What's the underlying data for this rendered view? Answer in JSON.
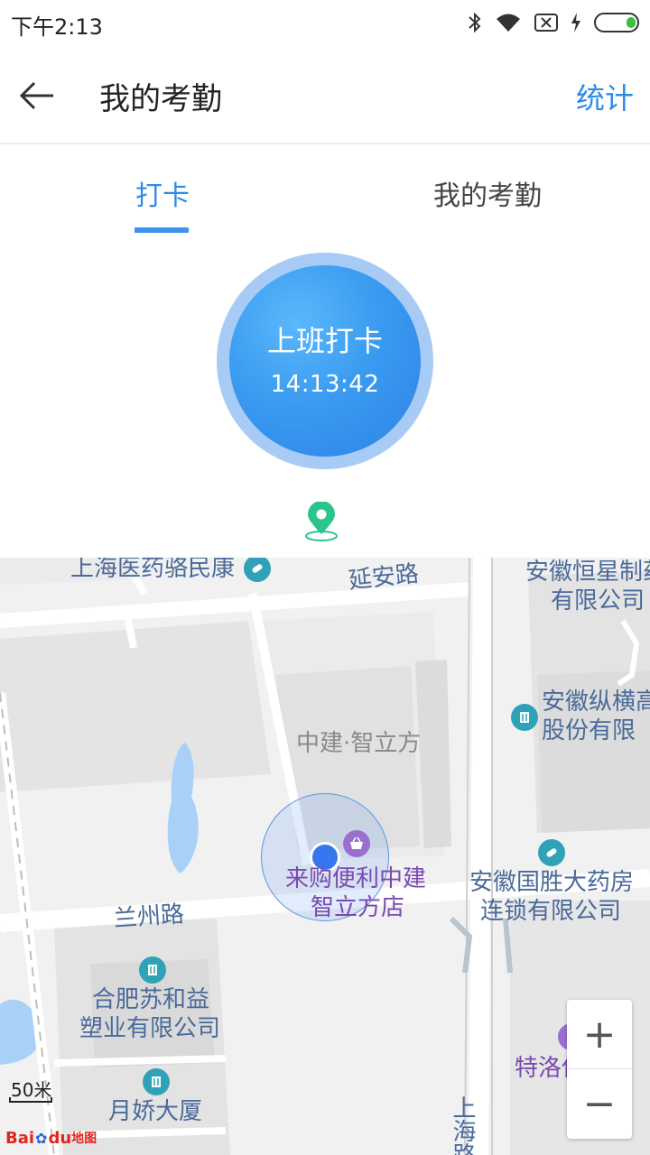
{
  "status_bar": {
    "time": "下午2:13"
  },
  "header": {
    "title": "我的考勤",
    "stats_label": "统计"
  },
  "tabs": [
    {
      "label": "打卡",
      "active": true
    },
    {
      "label": "我的考勤",
      "active": false
    }
  ],
  "punch": {
    "label": "上班打卡",
    "time": "14:13:42"
  },
  "colors": {
    "accent": "#2f8bea",
    "punch_blue": "#3a9bf0",
    "pin_green": "#2bc48a"
  },
  "map": {
    "labels": {
      "poi_pharmacy_top": "上海医药骆民康",
      "road_yanan": "延安路",
      "company_hengxing_1": "安徽恒星制药",
      "company_hengxing_2": "有限公司",
      "company_zongheng_1": "安徽纵横高",
      "company_zongheng_2": "股份有限",
      "building_zhonglifang": "中建·智立方",
      "store_1": "来购便利中建",
      "store_2": "智立方店",
      "pharmacy_guosheng_1": "安徽国胜大药房",
      "pharmacy_guosheng_2": "连锁有限公司",
      "road_lanzhou": "兰州路",
      "company_suheyi_1": "合肥苏和益",
      "company_suheyi_2": "塑业有限公司",
      "building_yuejiao": "月娇大厦",
      "poi_teluo": "特洛伊国际",
      "road_shanghai": "上海路"
    },
    "zoom_in": "+",
    "zoom_out": "−",
    "scale": "50米",
    "logo_text": "Bai",
    "logo_text_2": "du",
    "logo_text_3": "地图"
  }
}
